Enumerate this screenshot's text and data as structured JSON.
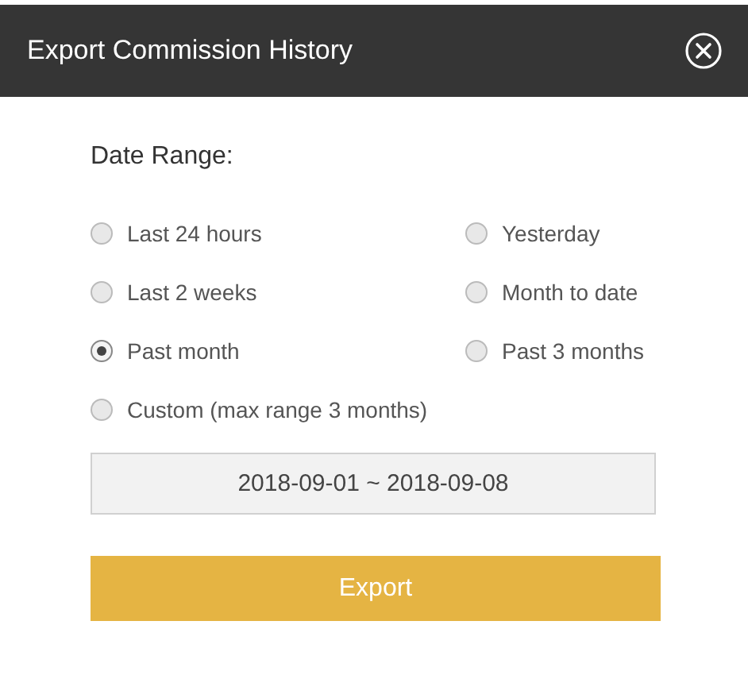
{
  "dialog": {
    "title": "Export Commission History"
  },
  "date_range": {
    "label": "Date Range:",
    "options": [
      {
        "label": "Last 24 hours",
        "selected": false
      },
      {
        "label": "Yesterday",
        "selected": false
      },
      {
        "label": "Last 2 weeks",
        "selected": false
      },
      {
        "label": "Month to date",
        "selected": false
      },
      {
        "label": "Past month",
        "selected": true
      },
      {
        "label": "Past 3 months",
        "selected": false
      },
      {
        "label": "Custom (max range 3 months)",
        "selected": false
      }
    ],
    "value": "2018-09-01 ~ 2018-09-08"
  },
  "buttons": [
    "Export"
  ]
}
